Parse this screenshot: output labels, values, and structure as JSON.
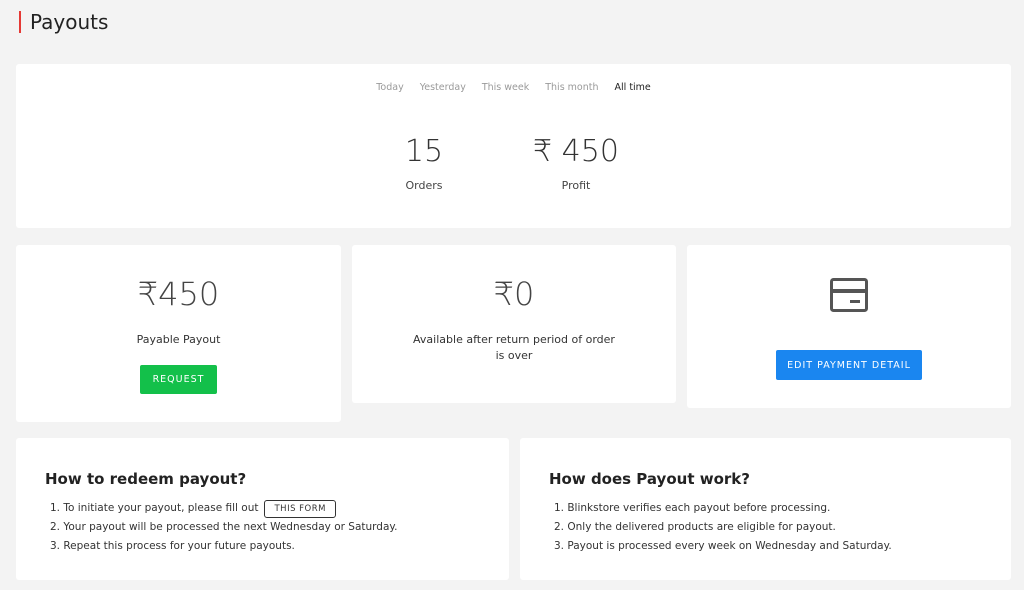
{
  "page": {
    "title": "Payouts"
  },
  "filters": [
    {
      "label": "Today",
      "active": false
    },
    {
      "label": "Yesterday",
      "active": false
    },
    {
      "label": "This week",
      "active": false
    },
    {
      "label": "This month",
      "active": false
    },
    {
      "label": "All time",
      "active": true
    }
  ],
  "stats": {
    "orders": {
      "value": "15",
      "label": "Orders"
    },
    "profit": {
      "value": "₹ 450",
      "label": "Profit"
    }
  },
  "payable": {
    "amount": "₹450",
    "caption": "Payable Payout",
    "button": "REQUEST"
  },
  "available": {
    "amount": "₹0",
    "caption": "Available after return period of order is over"
  },
  "payment": {
    "icon": "credit-card-icon",
    "button": "EDIT PAYMENT DETAIL"
  },
  "redeem": {
    "title": "How to redeem payout?",
    "items": [
      "1. To initiate your payout, please fill out",
      "2. Your payout will be processed the next Wednesday or Saturday.",
      "3. Repeat this process for your future payouts."
    ],
    "form_link": "THIS FORM"
  },
  "how": {
    "title": "How does Payout work?",
    "items": [
      "1. Blinkstore verifies each payout before processing.",
      "2. Only the delivered products are eligible for payout.",
      "3. Payout is processed every week on Wednesday and Saturday."
    ]
  },
  "colors": {
    "accent": "#e53935",
    "request": "#13c04a",
    "edit": "#1a86f0"
  }
}
